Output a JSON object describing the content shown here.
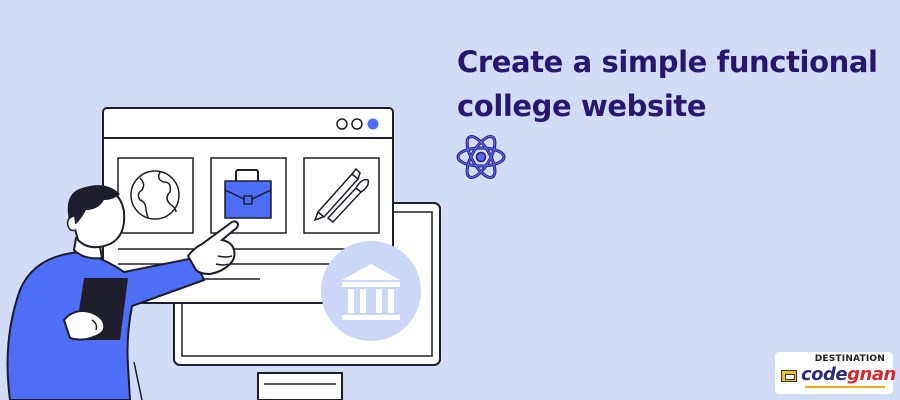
{
  "headline": {
    "line1": "Create a simple functional",
    "line2": "college website"
  },
  "icons": {
    "react": "react-atom-icon",
    "globe": "globe-icon",
    "briefcase": "briefcase-icon",
    "tools": "pencil-brush-icon",
    "building": "college-building-icon"
  },
  "logo": {
    "top_text": "DESTINATION",
    "main_text": "codegnan",
    "main_prefix": "code",
    "main_suffix": "gnan"
  },
  "colors": {
    "background": "#d3dcf6",
    "title": "#28166f",
    "accent_blue": "#4f6ef7",
    "outline": "#1d1d2b"
  }
}
